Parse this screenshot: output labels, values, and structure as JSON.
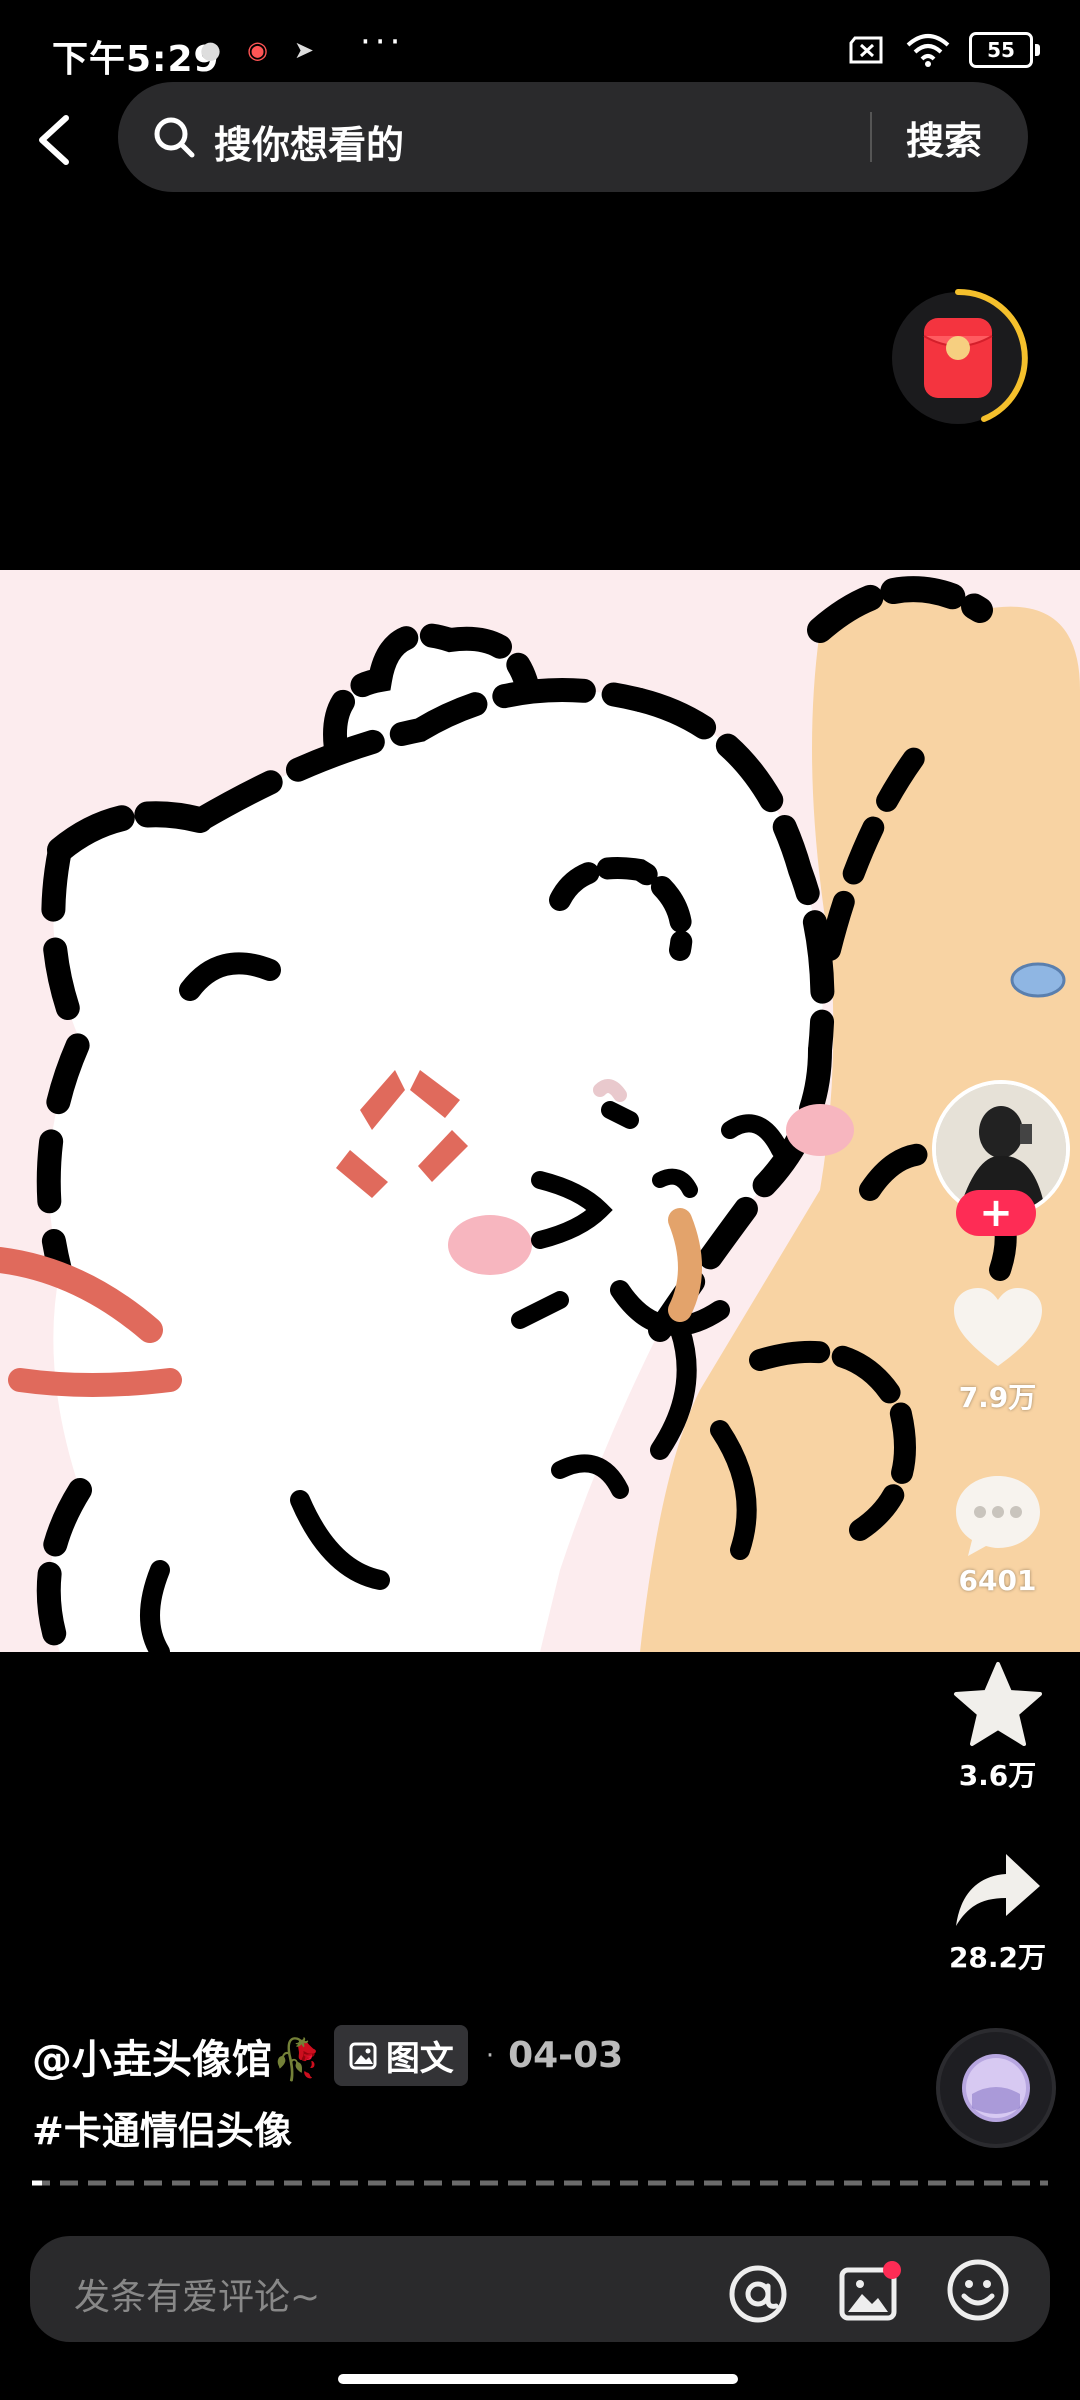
{
  "status_bar": {
    "time": "下午5:29",
    "dots": "···",
    "battery": "55",
    "icons": [
      "app-notification-icon",
      "app-notification-icon",
      "telegram-icon",
      "sim-x-icon",
      "wifi-icon",
      "battery-icon"
    ]
  },
  "search": {
    "placeholder": "搜你想看的",
    "button_label": "搜索"
  },
  "actions": {
    "likes": "7.9万",
    "comments": "6401",
    "favorites": "3.6万",
    "shares": "28.2万",
    "follow_symbol": "+"
  },
  "post": {
    "author": "@小垚头像馆🥀",
    "type_label": "图文",
    "separator": "·",
    "date": "04-03",
    "hashtag": "#卡通情侣头像"
  },
  "comment_bar": {
    "placeholder": "发条有爱评论~"
  },
  "colors": {
    "accent": "#fe2c55",
    "background": "#000000",
    "surface": "#2a2a2c",
    "reward_ring": "#f5c02c"
  }
}
